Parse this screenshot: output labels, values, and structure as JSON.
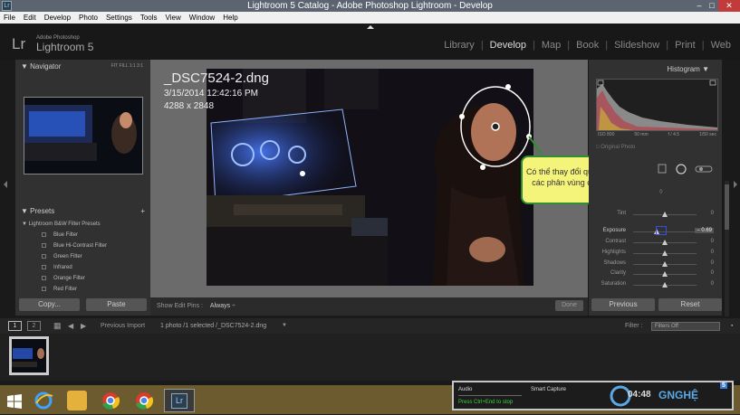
{
  "window": {
    "title": "Lightroom 5 Catalog - Adobe Photoshop Lightroom - Develop"
  },
  "menu": [
    "File",
    "Edit",
    "Develop",
    "Photo",
    "Settings",
    "Tools",
    "View",
    "Window",
    "Help"
  ],
  "identity": {
    "logo": "Lr",
    "adobe": "Adobe Photoshop",
    "app": "Lightroom 5"
  },
  "modules": [
    "Library",
    "Develop",
    "Map",
    "Book",
    "Slideshow",
    "Print",
    "Web"
  ],
  "left": {
    "navigator_title": "Navigator",
    "nav_options": "FIT   FILL   1:1   3:1",
    "presets_title": "Presets",
    "preset_group": "Lightroom B&W Filter Presets",
    "presets": [
      "Blue Filter",
      "Blue Hi-Contrast Filter",
      "Green Filter",
      "Infrared",
      "Orange Filter",
      "Red Filter"
    ],
    "copy_label": "Copy...",
    "paste_label": "Paste"
  },
  "center": {
    "filename": "_DSC7524-2.dng",
    "datetime": "3/15/2014 12:42:16 PM",
    "dimensions": "4288 x 2848",
    "show_pins_label": "Show Edit Pins :",
    "show_pins_value": "Always",
    "done_label": "Done",
    "tooltip_line1": "Có thể thay đổi qua lại giữa",
    "tooltip_line2": "các phân vùng cần xử lý"
  },
  "right": {
    "histogram_title": "Histogram",
    "iso": "ISO 800",
    "focal": "50 mm",
    "aperture": "f / 4.5",
    "shutter": "1/50 sec",
    "original_photo": "Original Photo",
    "sliders": [
      {
        "label": "Tint",
        "value": "0",
        "level": 0.5
      },
      {
        "label": "Exposure",
        "value": "– 0.69",
        "level": 0.37
      },
      {
        "label": "Contrast",
        "value": "0",
        "level": 0.5
      },
      {
        "label": "Highlights",
        "value": "0",
        "level": 0.5
      },
      {
        "label": "Shadows",
        "value": "0",
        "level": 0.5
      },
      {
        "label": "Clarity",
        "value": "0",
        "level": 0.5
      },
      {
        "label": "Saturation",
        "value": "0",
        "level": 0.5
      }
    ],
    "previous_label": "Previous",
    "reset_label": "Reset"
  },
  "filmbar": {
    "page1": "1",
    "page2": "2",
    "previous_import": "Previous Import",
    "selection": "1 photo /1 selected /_DSC7524-2.dng",
    "filter_label": "Filter :",
    "filter_value": "Filters Off"
  },
  "recorder": {
    "audio": "Audio",
    "smart_capture": "Smart Capture",
    "hint": "Press Ctrl+End to stop",
    "time": "04:48",
    "brand": "GNGHỆ",
    "badge": "5"
  },
  "colors": {
    "accent_green": "#2f8e2f",
    "tooltip": "#f4f47a",
    "taskbar": "#6b5b2e"
  }
}
